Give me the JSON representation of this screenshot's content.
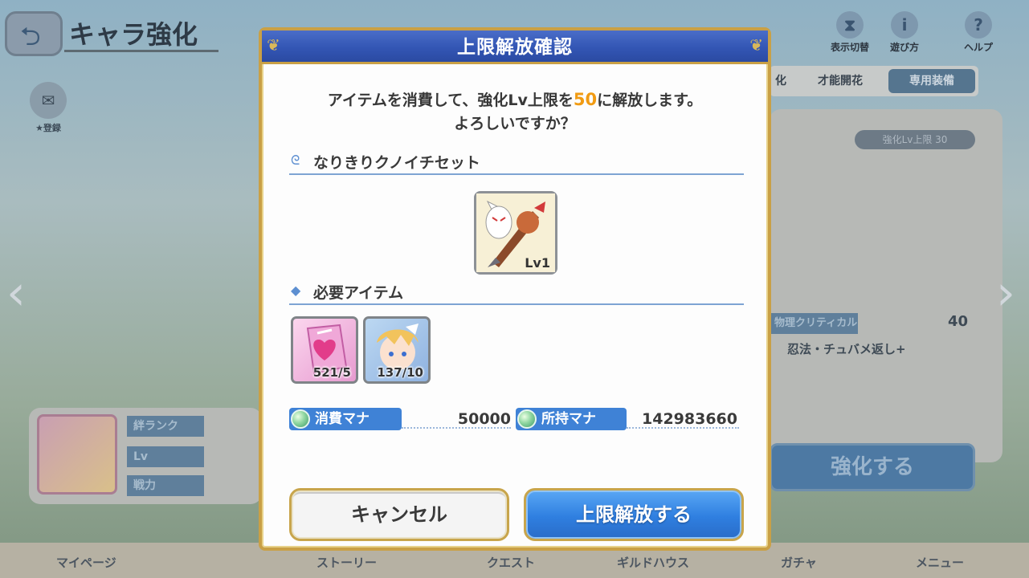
{
  "background": {
    "screen_title": "キャラ強化",
    "top_icons": [
      {
        "label": "表示切替",
        "icon": "hourglass-icon"
      },
      {
        "label": "遊び方",
        "icon": "info-icon"
      },
      {
        "label": "ヘルプ",
        "icon": "help-icon"
      }
    ],
    "tabs": [
      "化",
      "才能開花",
      "専用装備"
    ],
    "side_badge_label": "★登録",
    "limit_pill": "強化Lv上限 30",
    "crit_label": "物理クリティカル",
    "crit_value": "40",
    "skill_name": "忍法・チュバメ返し+",
    "stat_labels": [
      "絆ランク",
      "Lv",
      "戦力"
    ],
    "enhance_button": "強化する",
    "bottom_nav": [
      "マイページ",
      "ストーリー",
      "クエスト",
      "ギルドハウス",
      "ガチャ",
      "メニュー"
    ]
  },
  "dialog": {
    "title": "上限解放確認",
    "message_prefix": "アイテムを消費して、強化Lv上限を",
    "message_level": "50",
    "message_suffix": "に解放します。",
    "message_line2": "よろしいですか？",
    "equipment_section": "なりきりクノイチセット",
    "equipment_level": "Lv1",
    "required_section": "必要アイテム",
    "required_items": [
      {
        "name": "heart-memory-piece",
        "count": "521/5"
      },
      {
        "name": "character-memory-piece",
        "count": "137/10"
      }
    ],
    "cost_label": "消費マナ",
    "cost_value": "50000",
    "owned_label": "所持マナ",
    "owned_value": "142983660",
    "cancel_label": "キャンセル",
    "confirm_label": "上限解放する"
  },
  "colors": {
    "header_blue": "#3356b4",
    "gold_frame": "#c9a046",
    "accent_orange": "#f19b12",
    "tag_blue": "#3f82d6"
  }
}
